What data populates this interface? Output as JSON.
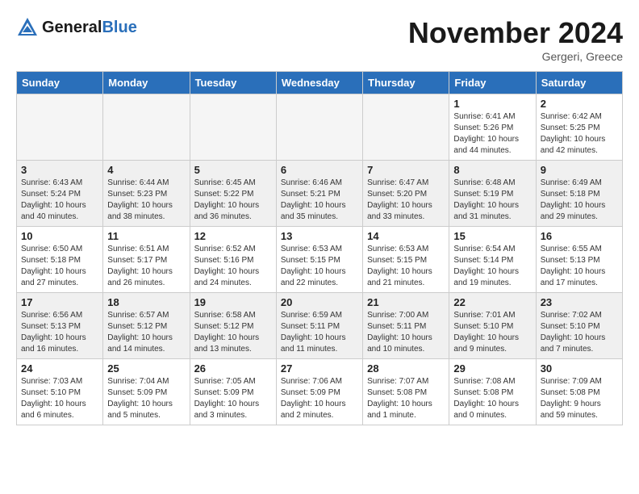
{
  "logo": {
    "text_general": "General",
    "text_blue": "Blue"
  },
  "header": {
    "month_title": "November 2024",
    "location": "Gergeri, Greece"
  },
  "weekdays": [
    "Sunday",
    "Monday",
    "Tuesday",
    "Wednesday",
    "Thursday",
    "Friday",
    "Saturday"
  ],
  "weeks": [
    [
      {
        "day": "",
        "info": "",
        "empty": true
      },
      {
        "day": "",
        "info": "",
        "empty": true
      },
      {
        "day": "",
        "info": "",
        "empty": true
      },
      {
        "day": "",
        "info": "",
        "empty": true
      },
      {
        "day": "",
        "info": "",
        "empty": true
      },
      {
        "day": "1",
        "info": "Sunrise: 6:41 AM\nSunset: 5:26 PM\nDaylight: 10 hours\nand 44 minutes."
      },
      {
        "day": "2",
        "info": "Sunrise: 6:42 AM\nSunset: 5:25 PM\nDaylight: 10 hours\nand 42 minutes."
      }
    ],
    [
      {
        "day": "3",
        "info": "Sunrise: 6:43 AM\nSunset: 5:24 PM\nDaylight: 10 hours\nand 40 minutes."
      },
      {
        "day": "4",
        "info": "Sunrise: 6:44 AM\nSunset: 5:23 PM\nDaylight: 10 hours\nand 38 minutes."
      },
      {
        "day": "5",
        "info": "Sunrise: 6:45 AM\nSunset: 5:22 PM\nDaylight: 10 hours\nand 36 minutes."
      },
      {
        "day": "6",
        "info": "Sunrise: 6:46 AM\nSunset: 5:21 PM\nDaylight: 10 hours\nand 35 minutes."
      },
      {
        "day": "7",
        "info": "Sunrise: 6:47 AM\nSunset: 5:20 PM\nDaylight: 10 hours\nand 33 minutes."
      },
      {
        "day": "8",
        "info": "Sunrise: 6:48 AM\nSunset: 5:19 PM\nDaylight: 10 hours\nand 31 minutes."
      },
      {
        "day": "9",
        "info": "Sunrise: 6:49 AM\nSunset: 5:18 PM\nDaylight: 10 hours\nand 29 minutes."
      }
    ],
    [
      {
        "day": "10",
        "info": "Sunrise: 6:50 AM\nSunset: 5:18 PM\nDaylight: 10 hours\nand 27 minutes."
      },
      {
        "day": "11",
        "info": "Sunrise: 6:51 AM\nSunset: 5:17 PM\nDaylight: 10 hours\nand 26 minutes."
      },
      {
        "day": "12",
        "info": "Sunrise: 6:52 AM\nSunset: 5:16 PM\nDaylight: 10 hours\nand 24 minutes."
      },
      {
        "day": "13",
        "info": "Sunrise: 6:53 AM\nSunset: 5:15 PM\nDaylight: 10 hours\nand 22 minutes."
      },
      {
        "day": "14",
        "info": "Sunrise: 6:53 AM\nSunset: 5:15 PM\nDaylight: 10 hours\nand 21 minutes."
      },
      {
        "day": "15",
        "info": "Sunrise: 6:54 AM\nSunset: 5:14 PM\nDaylight: 10 hours\nand 19 minutes."
      },
      {
        "day": "16",
        "info": "Sunrise: 6:55 AM\nSunset: 5:13 PM\nDaylight: 10 hours\nand 17 minutes."
      }
    ],
    [
      {
        "day": "17",
        "info": "Sunrise: 6:56 AM\nSunset: 5:13 PM\nDaylight: 10 hours\nand 16 minutes."
      },
      {
        "day": "18",
        "info": "Sunrise: 6:57 AM\nSunset: 5:12 PM\nDaylight: 10 hours\nand 14 minutes."
      },
      {
        "day": "19",
        "info": "Sunrise: 6:58 AM\nSunset: 5:12 PM\nDaylight: 10 hours\nand 13 minutes."
      },
      {
        "day": "20",
        "info": "Sunrise: 6:59 AM\nSunset: 5:11 PM\nDaylight: 10 hours\nand 11 minutes."
      },
      {
        "day": "21",
        "info": "Sunrise: 7:00 AM\nSunset: 5:11 PM\nDaylight: 10 hours\nand 10 minutes."
      },
      {
        "day": "22",
        "info": "Sunrise: 7:01 AM\nSunset: 5:10 PM\nDaylight: 10 hours\nand 9 minutes."
      },
      {
        "day": "23",
        "info": "Sunrise: 7:02 AM\nSunset: 5:10 PM\nDaylight: 10 hours\nand 7 minutes."
      }
    ],
    [
      {
        "day": "24",
        "info": "Sunrise: 7:03 AM\nSunset: 5:10 PM\nDaylight: 10 hours\nand 6 minutes."
      },
      {
        "day": "25",
        "info": "Sunrise: 7:04 AM\nSunset: 5:09 PM\nDaylight: 10 hours\nand 5 minutes."
      },
      {
        "day": "26",
        "info": "Sunrise: 7:05 AM\nSunset: 5:09 PM\nDaylight: 10 hours\nand 3 minutes."
      },
      {
        "day": "27",
        "info": "Sunrise: 7:06 AM\nSunset: 5:09 PM\nDaylight: 10 hours\nand 2 minutes."
      },
      {
        "day": "28",
        "info": "Sunrise: 7:07 AM\nSunset: 5:08 PM\nDaylight: 10 hours\nand 1 minute."
      },
      {
        "day": "29",
        "info": "Sunrise: 7:08 AM\nSunset: 5:08 PM\nDaylight: 10 hours\nand 0 minutes."
      },
      {
        "day": "30",
        "info": "Sunrise: 7:09 AM\nSunset: 5:08 PM\nDaylight: 9 hours\nand 59 minutes."
      }
    ]
  ]
}
